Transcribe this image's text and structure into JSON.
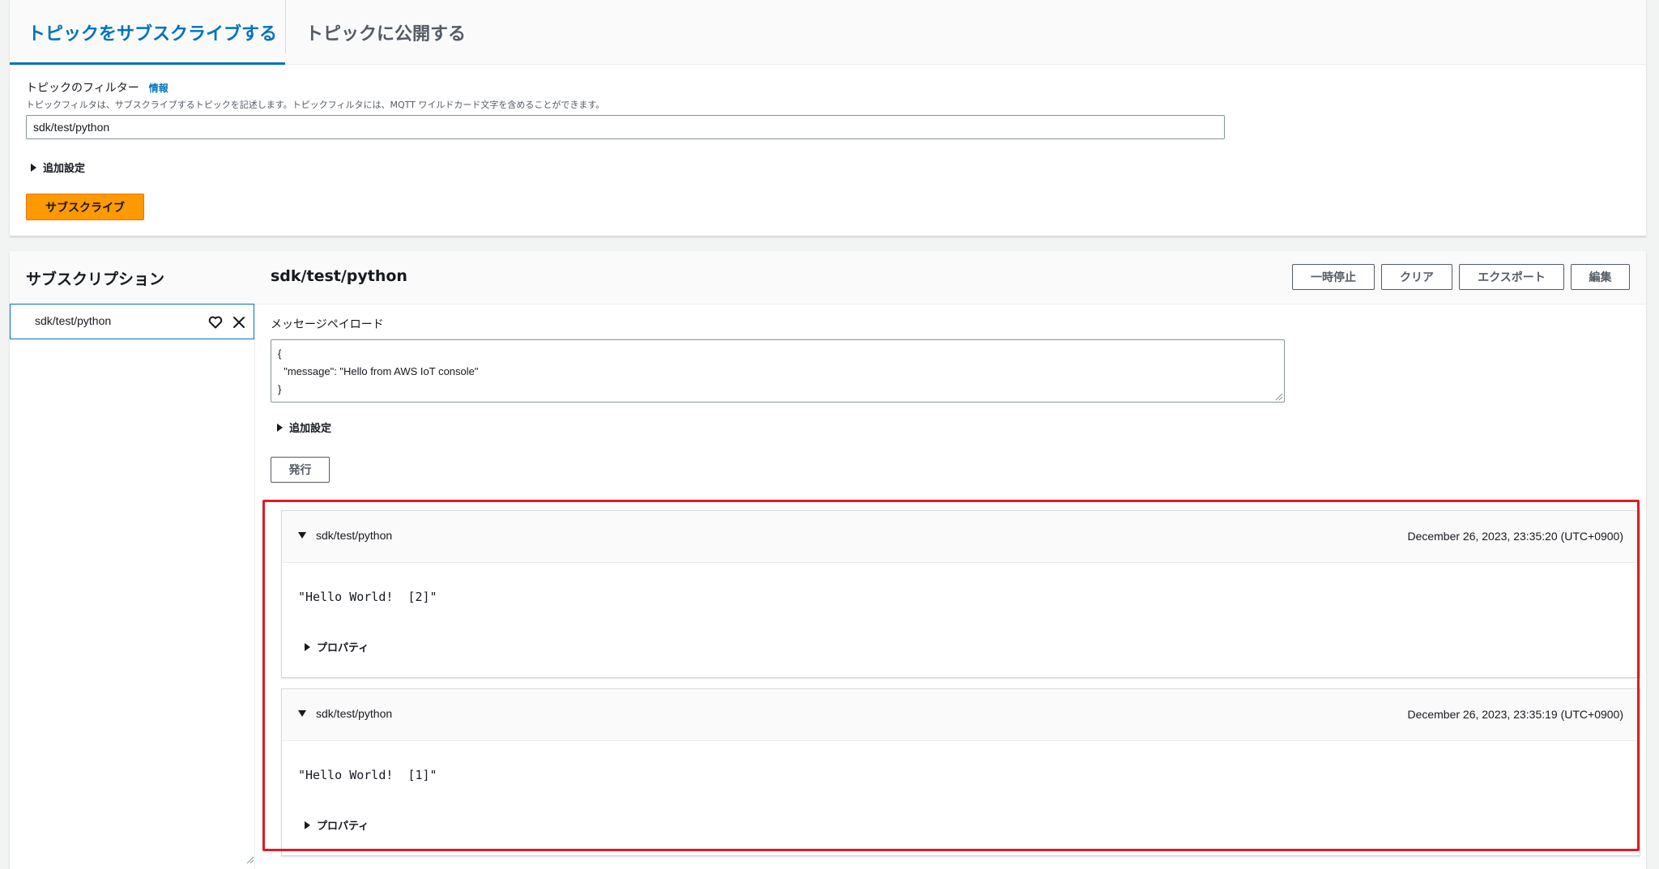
{
  "tabs": {
    "subscribe": "トピックをサブスクライブする",
    "publish": "トピックに公開する"
  },
  "filter": {
    "label": "トピックのフィルター",
    "info": "情報",
    "description": "トピックフィルタは、サブスクライブするトピックを記述します。トピックフィルタには、MQTT ワイルドカード文字を含めることができます。",
    "value": "sdk/test/python",
    "additional_settings": "追加設定",
    "subscribe_button": "サブスクライブ"
  },
  "subscriptions": {
    "title": "サブスクリプション",
    "items": [
      {
        "label": "sdk/test/python"
      }
    ]
  },
  "panel": {
    "topic": "sdk/test/python",
    "buttons": {
      "pause": "一時停止",
      "clear": "クリア",
      "export": "エクスポート",
      "edit": "編集"
    },
    "payload_label": "メッセージペイロード",
    "payload_value": "{\n  \"message\": \"Hello from AWS IoT console\"\n}",
    "additional_settings": "追加設定",
    "publish_button": "発行"
  },
  "messages": [
    {
      "topic": "sdk/test/python",
      "timestamp": "December 26, 2023, 23:35:20 (UTC+0900)",
      "body": "\"Hello World!  [2]\"",
      "properties": "プロパティ"
    },
    {
      "topic": "sdk/test/python",
      "timestamp": "December 26, 2023, 23:35:19 (UTC+0900)",
      "body": "\"Hello World!  [1]\"",
      "properties": "プロパティ"
    }
  ],
  "colors": {
    "accent": "#0073bb",
    "primary_button": "#ff9900",
    "highlight": "#e01b24"
  }
}
